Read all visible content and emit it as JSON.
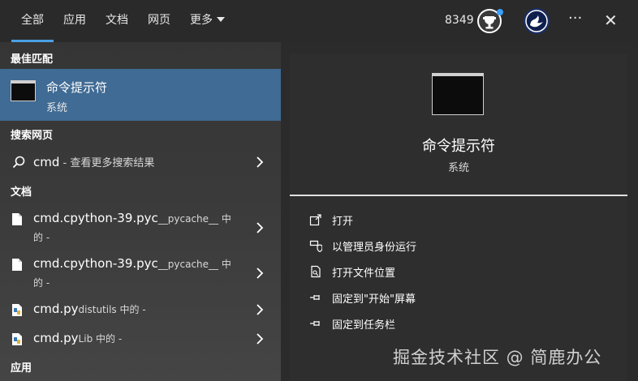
{
  "tabs": [
    {
      "label": "全部",
      "active": true
    },
    {
      "label": "应用",
      "active": false
    },
    {
      "label": "文档",
      "active": false
    },
    {
      "label": "网页",
      "active": false
    },
    {
      "label": "更多",
      "active": false
    }
  ],
  "header": {
    "points": "8349",
    "more_label": "···",
    "close_label": "✕"
  },
  "left": {
    "best_match_heading": "最佳匹配",
    "best_match": {
      "title": "命令提示符",
      "subtitle": "系统"
    },
    "web_heading": "搜索网页",
    "web_result": {
      "query": "cmd",
      "suffix": " - 查看更多搜索结果"
    },
    "docs_heading": "文档",
    "docs": [
      {
        "name": "cmd.cpython-39.pyc",
        "location": "__pycache__ 中",
        "line2": "的 -"
      },
      {
        "name": "cmd.cpython-39.pyc",
        "location": "__pycache__ 中",
        "line2": "的 -"
      },
      {
        "name": "cmd.py",
        "location": "distutils 中的 -"
      },
      {
        "name": "cmd.py",
        "location": "Lib 中的 -"
      }
    ],
    "apps_heading": "应用"
  },
  "right": {
    "app_name": "命令提示符",
    "app_sub": "系统",
    "actions": [
      {
        "label": "打开",
        "icon": "open-icon"
      },
      {
        "label": "以管理员身份运行",
        "icon": "shield-admin-icon"
      },
      {
        "label": "打开文件位置",
        "icon": "file-location-icon"
      },
      {
        "label": "固定到\"开始\"屏幕",
        "icon": "pin-icon"
      },
      {
        "label": "固定到任务栏",
        "icon": "pin-icon"
      }
    ]
  },
  "watermark": "掘金技术社区 @ 简鹿办公",
  "colors": {
    "accent": "#4aa0e6",
    "selected": "#3f6b94",
    "badge": "#3aa0ff"
  }
}
